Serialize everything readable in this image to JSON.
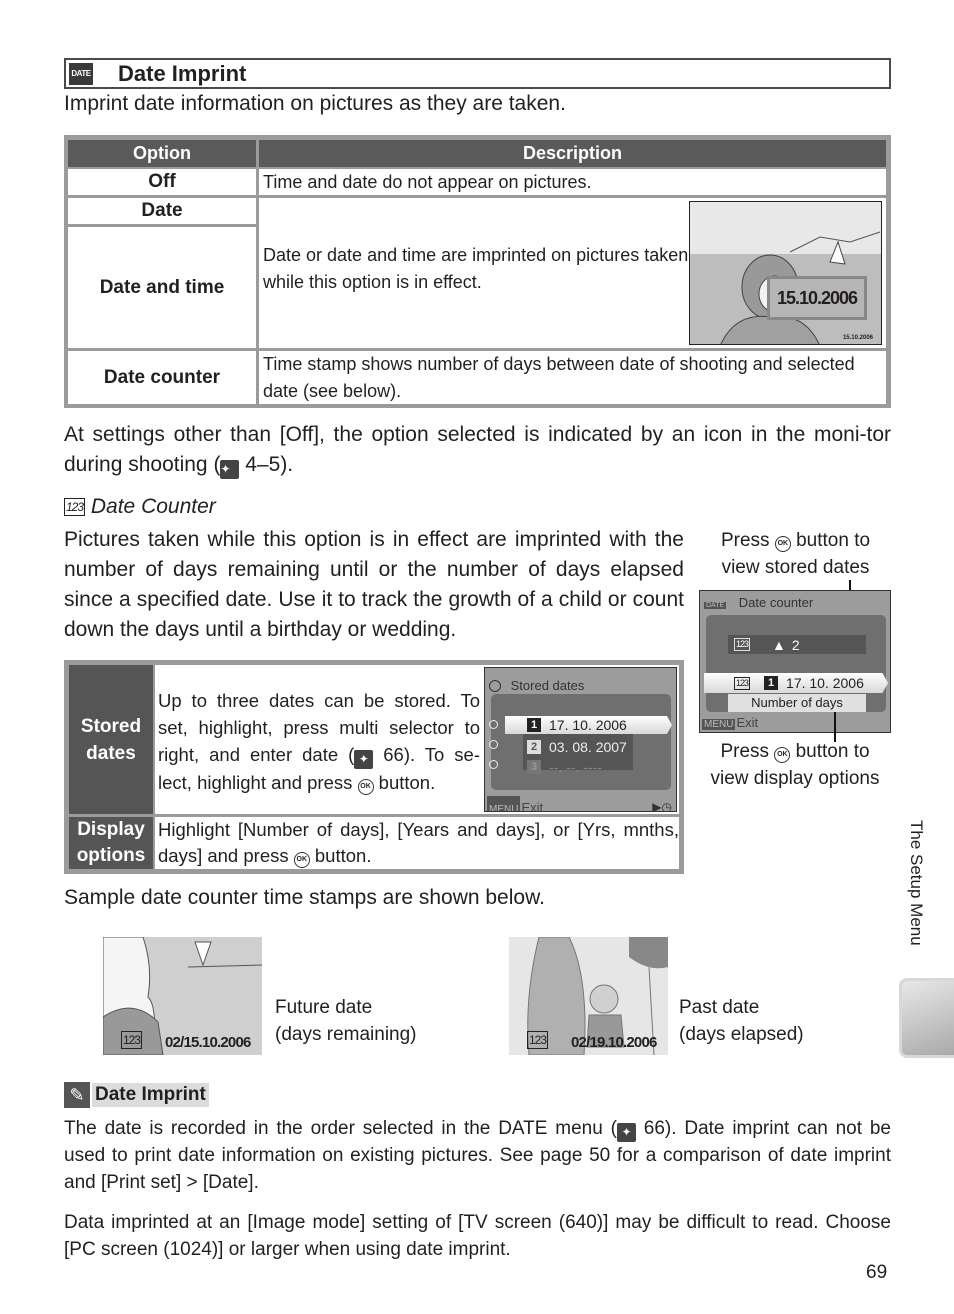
{
  "heading": {
    "icon": "DATE",
    "title": "Date Imprint",
    "intro": "Imprint date information on pictures as they are taken."
  },
  "options_table": {
    "headers": [
      "Option",
      "Description"
    ],
    "rows": [
      {
        "option": "Off",
        "description": "Time and date do not appear on pictures."
      },
      {
        "option": "Date",
        "description": ""
      },
      {
        "option": "Date and time",
        "description": "Date or date and time are imprinted on pictures taken while this option is in effect."
      },
      {
        "option": "Date counter",
        "description": "Time stamp shows number of days between date of shooting and selected date (see below)."
      }
    ],
    "illustration": {
      "callout_date": "15.10.2006",
      "small_date": "15.10.2006"
    }
  },
  "settings_note": {
    "before": "At settings other than [Off], the option selected is indicated by an icon in the moni-tor during shooting (",
    "ref": "4–5)."
  },
  "date_counter": {
    "icon": "123",
    "title": "Date Counter",
    "body": "Pictures taken while this option is in effect are imprinted with the number of days remaining until or the number of days elapsed since a specified date.  Use it to track the growth of a child or count down the days until a birthday or wedding."
  },
  "camera_screen": {
    "title": "Date counter",
    "counter_value": "2",
    "selected_date_index": "1",
    "selected_date": "17. 10. 2006",
    "display_option": "Number of days",
    "menu_label": "MENU",
    "exit_label": "Exit",
    "callout_top": [
      "Press",
      "button to",
      "view stored dates"
    ],
    "callout_bottom": [
      "Press",
      "button to",
      "view display options"
    ]
  },
  "stored_dates_table": {
    "rows": [
      {
        "label": [
          "Stored",
          "dates"
        ],
        "description_parts": [
          "Up to three dates can be stored.  To set, highlight, press multi selector to right, and enter date (",
          "66).  To se-lect, highlight and press",
          "button."
        ]
      },
      {
        "label": [
          "Display",
          "options"
        ],
        "description_parts": [
          "Highlight [Number of days], [Years and days], or [Yrs, mnths, days] and press",
          "button."
        ]
      }
    ],
    "screen": {
      "title": "Stored dates",
      "dates": [
        {
          "index": "1",
          "value": "17. 10. 2006",
          "selected": true
        },
        {
          "index": "2",
          "value": "03. 08. 2007",
          "selected": false
        },
        {
          "index": "3",
          "value": "--. --. ----",
          "selected": false
        }
      ],
      "menu_label": "MENU",
      "exit_label": "Exit"
    }
  },
  "samples": {
    "intro": "Sample date counter time stamps are shown below.",
    "items": [
      {
        "stamp": "02/15.10.2006",
        "label_line1": "Future date",
        "label_line2": "(days remaining)"
      },
      {
        "stamp": "02/19.10.2006",
        "label_line1": "Past date",
        "label_line2": "(days elapsed)"
      }
    ]
  },
  "note": {
    "title": "Date Imprint",
    "para1_before": "The date is recorded in the order selected in the DATE menu (",
    "para1_after": "66).  Date imprint can not be used to print date information on existing pictures.  See page 50 for a comparison of date imprint and [Print set] > [Date].",
    "para2": "Data imprinted at an [Image mode] setting of [TV screen (640)] may be difficult to read. Choose [PC screen (1024)] or larger when using date imprint."
  },
  "side_tab": "The Setup Menu",
  "page_number": "69"
}
